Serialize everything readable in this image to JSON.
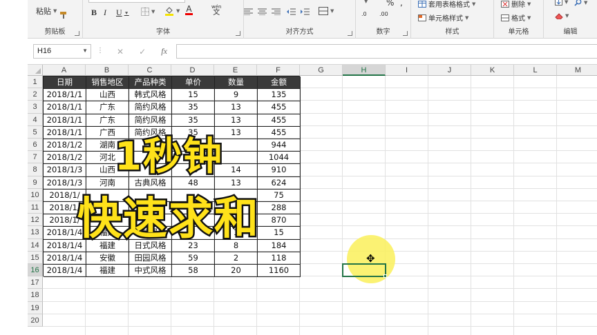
{
  "ribbon": {
    "clipboard": {
      "paste": "粘贴",
      "label": "剪贴板"
    },
    "font": {
      "bold": "B",
      "italic": "I",
      "underline": "U",
      "font_color": "A",
      "wen": "wén",
      "wen_char": "文",
      "label": "字体"
    },
    "alignment": {
      "label": "对齐方式"
    },
    "number": {
      "percent": "%",
      "comma": ",",
      "inc_decimal": ".0",
      "dec_decimal": ".00",
      "label": "数字"
    },
    "styles": {
      "format_as_table": "套用表格格式",
      "cell_styles": "单元格样式",
      "label": "样式"
    },
    "cells": {
      "delete": "删除",
      "format": "格式",
      "label": "单元格"
    },
    "editing": {
      "label": "编辑"
    }
  },
  "formula_bar": {
    "name_box": "H16",
    "fx": "fx",
    "cancel": "✕",
    "enter": "✓",
    "value": ""
  },
  "columns": [
    "A",
    "B",
    "C",
    "D",
    "E",
    "F",
    "G",
    "H",
    "I",
    "J",
    "K",
    "L",
    "M"
  ],
  "rows": [
    "1",
    "2",
    "3",
    "4",
    "5",
    "6",
    "7",
    "8",
    "9",
    "10",
    "11",
    "12",
    "13",
    "14",
    "15",
    "16",
    "17",
    "18",
    "19",
    "20"
  ],
  "table": {
    "headers": [
      "日期",
      "销售地区",
      "产品种类",
      "单价",
      "数量",
      "金额"
    ],
    "rows": [
      [
        "2018/1/1",
        "山西",
        "韩式风格",
        "15",
        "9",
        "135"
      ],
      [
        "2018/1/1",
        "广东",
        "简约风格",
        "35",
        "13",
        "455"
      ],
      [
        "2018/1/1",
        "广东",
        "简约风格",
        "35",
        "13",
        "455"
      ],
      [
        "2018/1/1",
        "广西",
        "简约风格",
        "35",
        "13",
        "455"
      ],
      [
        "2018/1/2",
        "湖南",
        "",
        "",
        "",
        "944"
      ],
      [
        "2018/1/2",
        "河北",
        "中",
        "",
        "",
        "1044"
      ],
      [
        "2018/1/3",
        "山西",
        "",
        "65",
        "14",
        "910"
      ],
      [
        "2018/1/3",
        "河南",
        "古典风格",
        "48",
        "13",
        "624"
      ],
      [
        "2018/1/",
        "",
        "",
        "",
        "",
        "75"
      ],
      [
        "2018/1/",
        "",
        "",
        "",
        "",
        "288"
      ],
      [
        "2018/1/",
        "",
        "",
        "",
        "",
        "870"
      ],
      [
        "2018/1/4",
        "福建",
        "韩式风格",
        "",
        "1",
        "15"
      ],
      [
        "2018/1/4",
        "福建",
        "日式风格",
        "23",
        "8",
        "184"
      ],
      [
        "2018/1/4",
        "安徽",
        "田园风格",
        "59",
        "2",
        "118"
      ],
      [
        "2018/1/4",
        "福建",
        "中式风格",
        "58",
        "20",
        "1160"
      ]
    ]
  },
  "selected_cell": "H16",
  "overlay": {
    "line1": "1秒钟",
    "line2": "快速求和"
  },
  "colors": {
    "accent": "#217346",
    "caption_fill": "#ffe21a",
    "caption_stroke": "#111111",
    "header_bg": "#3a3a3a"
  }
}
